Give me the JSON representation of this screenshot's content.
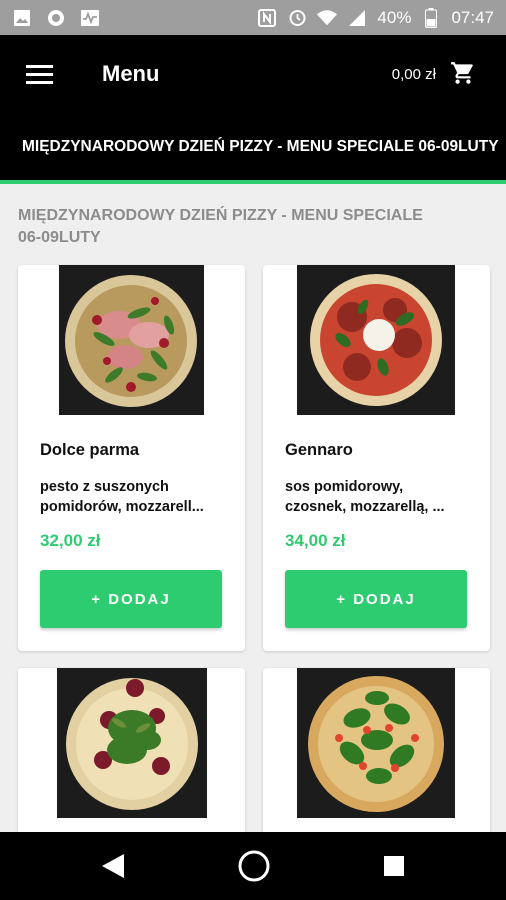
{
  "status_bar": {
    "battery": "40%",
    "time": "07:47",
    "left_icons": [
      "image-icon",
      "circle-app-icon",
      "activity-icon"
    ],
    "right_icons": [
      "nfc-icon",
      "alarm-icon",
      "wifi-icon",
      "signal-icon",
      "battery-icon"
    ]
  },
  "appbar": {
    "title": "Menu",
    "cart_total": "0,00 zł",
    "menu_icon": "hamburger-menu-icon",
    "cart_icon": "shopping-cart-icon"
  },
  "banner": {
    "text": "MIĘDZYNARODOWY DZIEŃ PIZZY - MENU SPECIALE 06-09LUTY"
  },
  "section": {
    "title_line1": "MIĘDZYNARODOWY DZIEŃ PIZZY - MENU SPECIALE",
    "title_line2": "06-09LUTY"
  },
  "products": [
    {
      "name": "Dolce parma",
      "desc_line1": "pesto z suszonych",
      "desc_line2": "pomidorów, mozzarell...",
      "price": "32,00 zł",
      "add_label": "+ DODAJ"
    },
    {
      "name": "Gennaro",
      "desc_line1": "sos pomidorowy,",
      "desc_line2": "czosnek, mozzarellą, ...",
      "price": "34,00 zł",
      "add_label": "+ DODAJ"
    }
  ],
  "colors": {
    "accent": "#2ecc71",
    "appbar_bg": "#000000",
    "status_bar_bg": "#9e9e9e",
    "page_bg": "#efefef",
    "section_title": "#8c8c8c"
  },
  "navbar_icons": [
    "back-icon",
    "home-icon",
    "recents-icon"
  ]
}
